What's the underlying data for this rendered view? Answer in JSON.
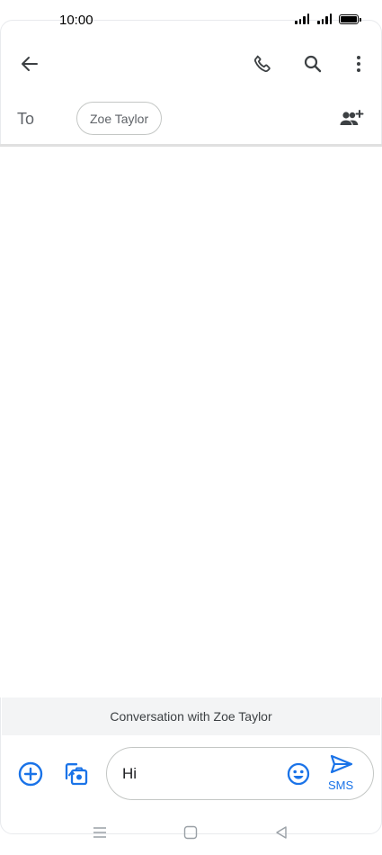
{
  "status_bar": {
    "time": "10:00",
    "icons": [
      "signal-icon",
      "signal-icon",
      "battery-icon"
    ]
  },
  "app_bar": {
    "icons": [
      "back-arrow-icon",
      "phone-icon",
      "search-icon",
      "more-vert-icon"
    ]
  },
  "recipient": {
    "to_label": "To",
    "chip_name": "Zoe Taylor",
    "add_icon": "add-person-icon"
  },
  "banner": {
    "text": "Conversation with Zoe Taylor"
  },
  "compose": {
    "text": "Hi",
    "send_label": "SMS",
    "icons": [
      "add-circle-icon",
      "gallery-camera-icon",
      "emoji-icon",
      "send-icon"
    ]
  },
  "nav_bar": {
    "icons": [
      "menu-lines-icon",
      "home-square-icon",
      "back-triangle-icon"
    ]
  },
  "colors": {
    "accent": "#1a73e8",
    "icon_dark": "#3c4043",
    "banner_bg": "#f3f4f5"
  }
}
